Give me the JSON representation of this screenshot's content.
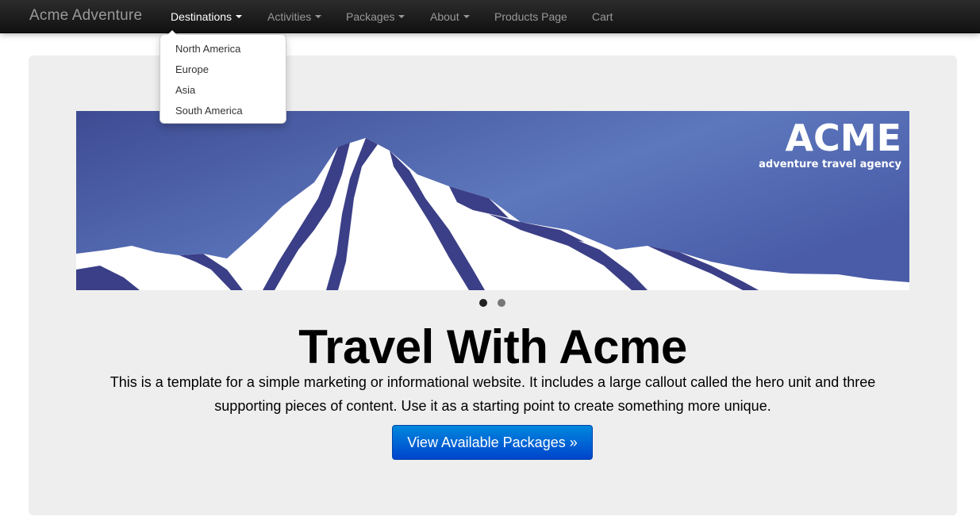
{
  "navbar": {
    "brand": "Acme Adventure",
    "items": [
      {
        "label": "Destinations",
        "dropdown": true
      },
      {
        "label": "Activities",
        "dropdown": true
      },
      {
        "label": "Packages",
        "dropdown": true
      },
      {
        "label": "About",
        "dropdown": true
      },
      {
        "label": "Products Page",
        "dropdown": false
      },
      {
        "label": "Cart",
        "dropdown": false
      }
    ]
  },
  "destinations_menu": {
    "items": [
      "North America",
      "Europe",
      "Asia",
      "South America"
    ]
  },
  "banner": {
    "logo_text": "ACME",
    "logo_tagline": "adventure travel agency",
    "sky_color": "#4b5ea6",
    "mountain_shadow_color": "#3b3f87"
  },
  "carousel": {
    "slides": 2,
    "active_index": 0
  },
  "hero": {
    "title": "Travel With Acme",
    "text": "This is a template for a simple marketing or informational website. It includes a large callout called the hero unit and three supporting pieces of content. Use it as a starting point to create something more unique.",
    "button_label": "View Available Packages »"
  }
}
